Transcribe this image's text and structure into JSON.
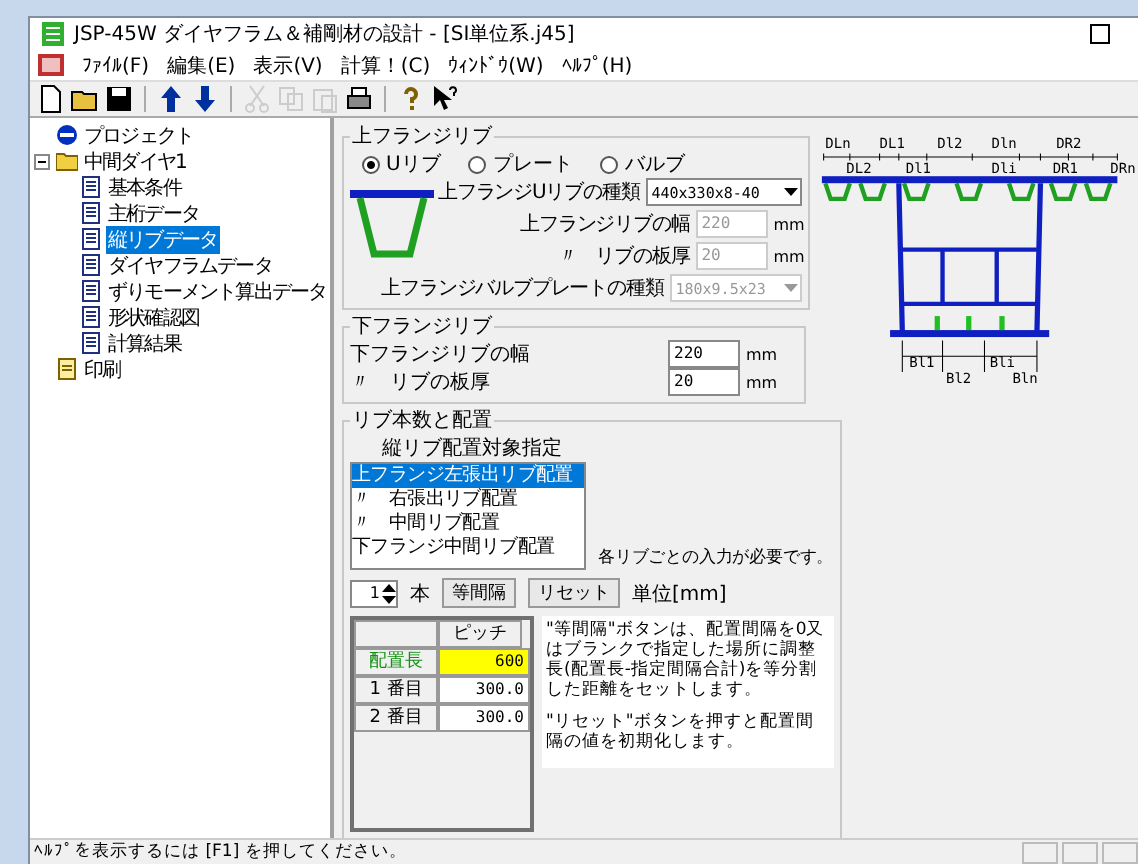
{
  "window": {
    "title": "JSP-45W ダイヤフラム＆補剛材の設計 - [SI単位系.j45]"
  },
  "menu": [
    "ﾌｧｲﾙ(F)",
    "編集(E)",
    "表示(V)",
    "計算！(C)",
    "ｳｨﾝﾄﾞｳ(W)",
    "ﾍﾙﾌﾟ(H)"
  ],
  "toolbar": [
    {
      "kind": "new",
      "disabled": false
    },
    {
      "kind": "open",
      "disabled": false
    },
    {
      "kind": "save",
      "disabled": false
    },
    {
      "kind": "sep"
    },
    {
      "kind": "up",
      "disabled": false
    },
    {
      "kind": "down",
      "disabled": false
    },
    {
      "kind": "sep"
    },
    {
      "kind": "cut",
      "disabled": true
    },
    {
      "kind": "copy",
      "disabled": true
    },
    {
      "kind": "paste",
      "disabled": true
    },
    {
      "kind": "print",
      "disabled": false
    },
    {
      "kind": "sep"
    },
    {
      "kind": "help",
      "disabled": false
    },
    {
      "kind": "whatsthis",
      "disabled": false
    }
  ],
  "tree": [
    {
      "label": "プロジェクト",
      "kind": "project",
      "selected": false
    },
    {
      "label": "中間ダイヤ1",
      "kind": "folder",
      "selected": false,
      "expanded": true,
      "children": [
        {
          "label": "基本条件",
          "kind": "doc",
          "selected": false
        },
        {
          "label": "主桁データ",
          "kind": "doc",
          "selected": false
        },
        {
          "label": "縦リブデータ",
          "kind": "doc",
          "selected": true
        },
        {
          "label": "ダイヤフラムデータ",
          "kind": "doc",
          "selected": false
        },
        {
          "label": "ずりモーメント算出データ",
          "kind": "doc",
          "selected": false
        },
        {
          "label": "形状確認図",
          "kind": "doc",
          "selected": false
        },
        {
          "label": "計算結果",
          "kind": "doc",
          "selected": false
        }
      ]
    },
    {
      "label": "印刷",
      "kind": "print",
      "selected": false
    }
  ],
  "upper_flange_rib": {
    "title": "上フランジリブ",
    "radios": [
      {
        "label": "Uリブ",
        "selected": true
      },
      {
        "label": "プレート",
        "selected": false
      },
      {
        "label": "バルブ",
        "selected": false
      }
    ],
    "fields": [
      {
        "kind": "select",
        "label": "上フランジUリブの種類",
        "value": "440x330x8-40",
        "disabled": false
      },
      {
        "kind": "input",
        "label": "上フランジリブの幅",
        "value": "220",
        "unit": "mm",
        "disabled": true
      },
      {
        "kind": "input",
        "label": "〃　リブの板厚",
        "value": "20",
        "unit": "mm",
        "disabled": true
      },
      {
        "kind": "select",
        "label": "上フランジバルブプレートの種類",
        "value": "180x9.5x23",
        "disabled": true
      }
    ]
  },
  "lower_flange_rib": {
    "title": "下フランジリブ",
    "fields": [
      {
        "label": "下フランジリブの幅",
        "value": "220",
        "unit": "mm",
        "disabled": false
      },
      {
        "label": "〃　リブの板厚",
        "value": "20",
        "unit": "mm",
        "disabled": false
      }
    ]
  },
  "rib_layout": {
    "title": "リブ本数と配置",
    "target_label": "縦リブ配置対象指定",
    "targets": [
      {
        "label": "上フランジ左張出リブ配置",
        "selected": true
      },
      {
        "label": "〃　右張出リブ配置",
        "selected": false
      },
      {
        "label": "〃　中間リブ配置",
        "selected": false
      },
      {
        "label": "下フランジ中間リブ配置",
        "selected": false
      }
    ],
    "note": "各リブごとの入力が必要です。",
    "count": "1",
    "count_unit": "本",
    "buttons": [
      "等間隔",
      "リセット"
    ],
    "unit": "単位[mm]",
    "table": {
      "column": "ピッチ",
      "rows": [
        {
          "label": "配置長",
          "value": "600",
          "kind": "total"
        },
        {
          "label": "1 番目",
          "value": "300.0",
          "kind": "pitch"
        },
        {
          "label": "2 番目",
          "value": "300.0",
          "kind": "pitch"
        }
      ]
    },
    "help": [
      "\"等間隔\"ボタンは、配置間隔を0又はブランクで指定した場所に調整長(配置長-指定間隔合計)を等分割した距離をセットします。",
      "\"リセット\"ボタンを押すと配置間隔の値を初期化します。"
    ]
  },
  "diagram": {
    "top_labels": [
      "DLn",
      "DL1",
      "Dl2",
      "Dln",
      "DR2"
    ],
    "mid_labels": [
      "DL2",
      "Dl1",
      "Dli",
      "DR1",
      "DRn"
    ],
    "bottom_labels": [
      "Bl1",
      "Bl2",
      "Bli",
      "Bln"
    ]
  },
  "status_bar": "ﾍﾙﾌﾟを表示するには [F1] を押してください。"
}
